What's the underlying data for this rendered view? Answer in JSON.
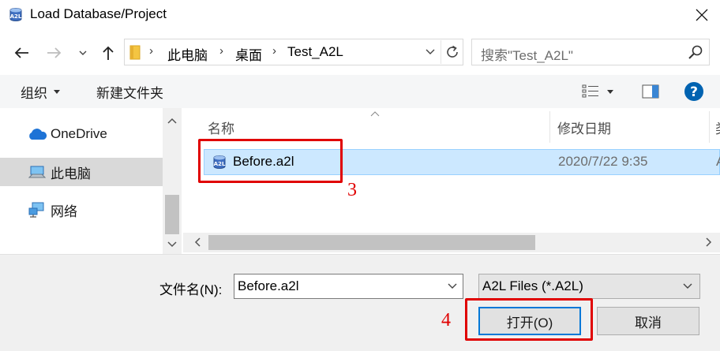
{
  "window": {
    "title": "Load Database/Project",
    "icon": "database-icon"
  },
  "address": {
    "breadcrumbs": [
      "此电脑",
      "桌面",
      "Test_A2L"
    ],
    "search_placeholder": "搜索\"Test_A2L\""
  },
  "toolbar": {
    "organize_label": "组织",
    "new_folder_label": "新建文件夹"
  },
  "nav_pane": {
    "items": [
      {
        "label": "OneDrive",
        "icon": "onedrive-cloud-icon"
      },
      {
        "label": "此电脑",
        "icon": "computer-icon",
        "selected": true
      },
      {
        "label": "网络",
        "icon": "network-icon"
      }
    ]
  },
  "file_list": {
    "columns": [
      "名称",
      "修改日期",
      "类"
    ],
    "rows": [
      {
        "name": "Before.a2l",
        "modified": "2020/7/22 9:35",
        "type": "A",
        "selected": true
      }
    ]
  },
  "bottom": {
    "filename_label": "文件名(N):",
    "filename_value": "Before.a2l",
    "filter_value": "A2L Files (*.A2L)",
    "open_label": "打开(O)",
    "cancel_label": "取消"
  },
  "annotations": {
    "step3": "3",
    "step4": "4"
  },
  "colors": {
    "selection_fill": "#cce8ff",
    "selection_border": "#99d1ff",
    "annotation_red": "#e00000",
    "focus_blue": "#0078d7",
    "help_blue": "#0063b1"
  }
}
